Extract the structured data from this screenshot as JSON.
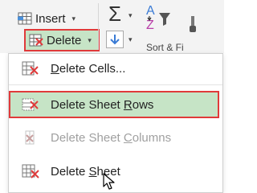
{
  "ribbon": {
    "insert_label": "Insert",
    "insert_caret": "▾",
    "delete_label": "Delete",
    "delete_caret": "▾",
    "autosum_symbol": "Σ",
    "autosum_caret": "▾",
    "fill_caret": "▾",
    "sort_label": "Sort & Fi"
  },
  "menu": {
    "items": [
      {
        "label_prefix": "",
        "label_mnemonic": "D",
        "label_rest": "elete Cells...",
        "enabled": true
      },
      {
        "label_prefix": "Delete Sheet ",
        "label_mnemonic": "R",
        "label_rest": "ows",
        "enabled": true
      },
      {
        "label_prefix": "Delete Sheet ",
        "label_mnemonic": "C",
        "label_rest": "olumns",
        "enabled": false
      },
      {
        "label_prefix": "Delete ",
        "label_mnemonic": "S",
        "label_rest": "heet",
        "enabled": true
      }
    ]
  },
  "colors": {
    "highlight_fill": "#c6e4c6",
    "highlight_border": "#e03a3a",
    "delete_icon_red": "#e03a3a"
  }
}
